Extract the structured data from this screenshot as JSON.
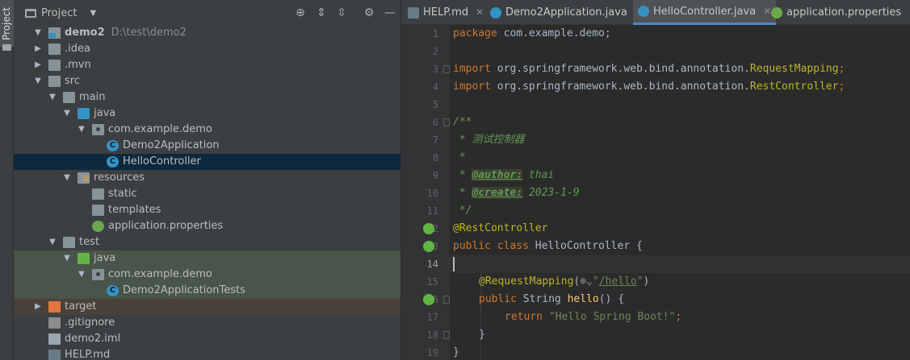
{
  "sidebar_strip": {
    "label": "Project"
  },
  "project_panel": {
    "title": "Project",
    "tree": [
      {
        "label": "demo2",
        "path": "D:\\test\\demo2"
      },
      {
        "label": ".idea"
      },
      {
        "label": ".mvn"
      },
      {
        "label": "src"
      },
      {
        "label": "main"
      },
      {
        "label": "java"
      },
      {
        "label": "com.example.demo"
      },
      {
        "label": "Demo2Application"
      },
      {
        "label": "HelloController"
      },
      {
        "label": "resources"
      },
      {
        "label": "static"
      },
      {
        "label": "templates"
      },
      {
        "label": "application.properties"
      },
      {
        "label": "test"
      },
      {
        "label": "java"
      },
      {
        "label": "com.example.demo"
      },
      {
        "label": "Demo2ApplicationTests"
      },
      {
        "label": "target"
      },
      {
        "label": ".gitignore"
      },
      {
        "label": "demo2.iml"
      },
      {
        "label": "HELP.md"
      }
    ]
  },
  "editor": {
    "tabs": [
      {
        "label": "HELP.md"
      },
      {
        "label": "Demo2Application.java"
      },
      {
        "label": "HelloController.java"
      },
      {
        "label": "application.properties"
      }
    ],
    "active_tab": "HelloController.java",
    "line_numbers": [
      "1",
      "2",
      "3",
      "4",
      "5",
      "6",
      "7",
      "8",
      "9",
      "10",
      "11",
      "12",
      "13",
      "14",
      "15",
      "16",
      "17",
      "18",
      "19"
    ],
    "code": {
      "l1_kw": "package",
      "l1_rest": " com.example.demo;",
      "l3_kw": "import",
      "l3_pkg": " org.springframework.web.bind.annotation.",
      "l3_cls": "RequestMapping",
      "l3_end": ";",
      "l4_kw": "import",
      "l4_pkg": " org.springframework.web.bind.annotation.",
      "l4_cls": "RestController",
      "l4_end": ";",
      "l6": "/**",
      "l7": " * 测试控制器",
      "l8": " *",
      "l9_star": " * ",
      "l9_tag": "@author:",
      "l9_val": " thai",
      "l10_star": " * ",
      "l10_tag": "@create:",
      "l10_val": " 2023-1-9",
      "l11": " */",
      "l12": "@RestController",
      "l13_kw": "public class",
      "l13_rest": " HelloController {",
      "l15_ann": "@RequestMapping",
      "l15_open": "(",
      "l15_q1": "\"",
      "l15_url": "/hello",
      "l15_q2": "\"",
      "l15_close": ")",
      "l16_kw": "public",
      "l16_type": " String ",
      "l16_fn": "hello",
      "l16_rest": "() {",
      "l17_kw": "return",
      "l17_str": " \"Hello Spring Boot!\"",
      "l17_end": ";",
      "l18": "}",
      "l19": "}"
    }
  },
  "colors": {
    "keyword": "#cc7832",
    "annotation": "#bbb529",
    "doc_comment": "#629755",
    "string": "#6a8759",
    "method": "#ffc66d",
    "selection": "#0d293e",
    "active_tab_underline": "#4a88c7"
  },
  "icons": [
    "folder-icon",
    "package-icon",
    "class-icon",
    "spring-icon",
    "properties-icon",
    "gear-icon",
    "locate-icon",
    "expand-all-icon",
    "collapse-all-icon",
    "minimize-icon",
    "close-icon"
  ]
}
